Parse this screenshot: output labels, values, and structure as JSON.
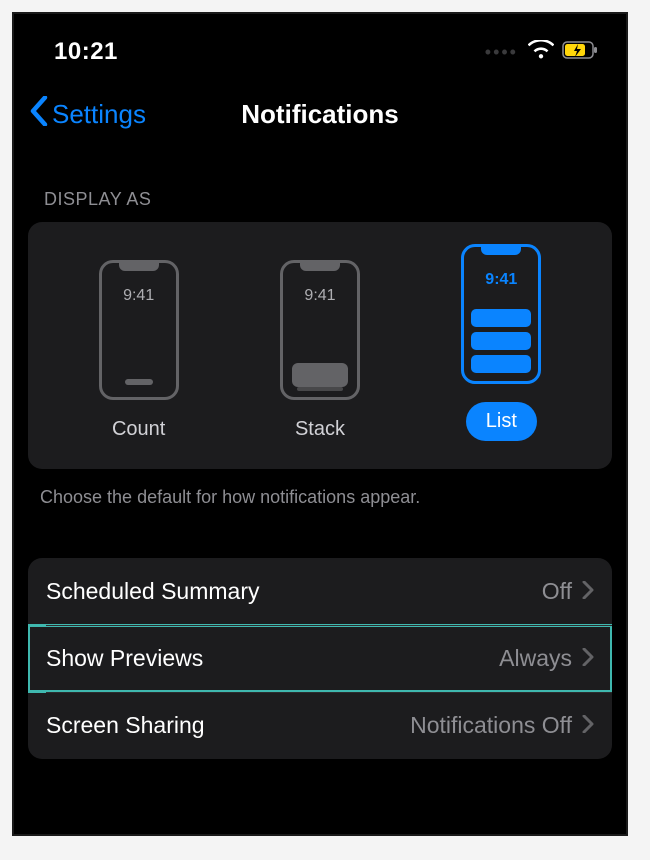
{
  "statusbar": {
    "time": "10:21"
  },
  "nav": {
    "back_label": "Settings",
    "title": "Notifications"
  },
  "display_as": {
    "section_header": "DISPLAY AS",
    "phone_time": "9:41",
    "modes": {
      "count": "Count",
      "stack": "Stack",
      "list": "List"
    },
    "footer": "Choose the default for how notifications appear."
  },
  "rows": {
    "scheduled_summary": {
      "label": "Scheduled Summary",
      "value": "Off"
    },
    "show_previews": {
      "label": "Show Previews",
      "value": "Always"
    },
    "screen_sharing": {
      "label": "Screen Sharing",
      "value": "Notifications Off"
    }
  }
}
